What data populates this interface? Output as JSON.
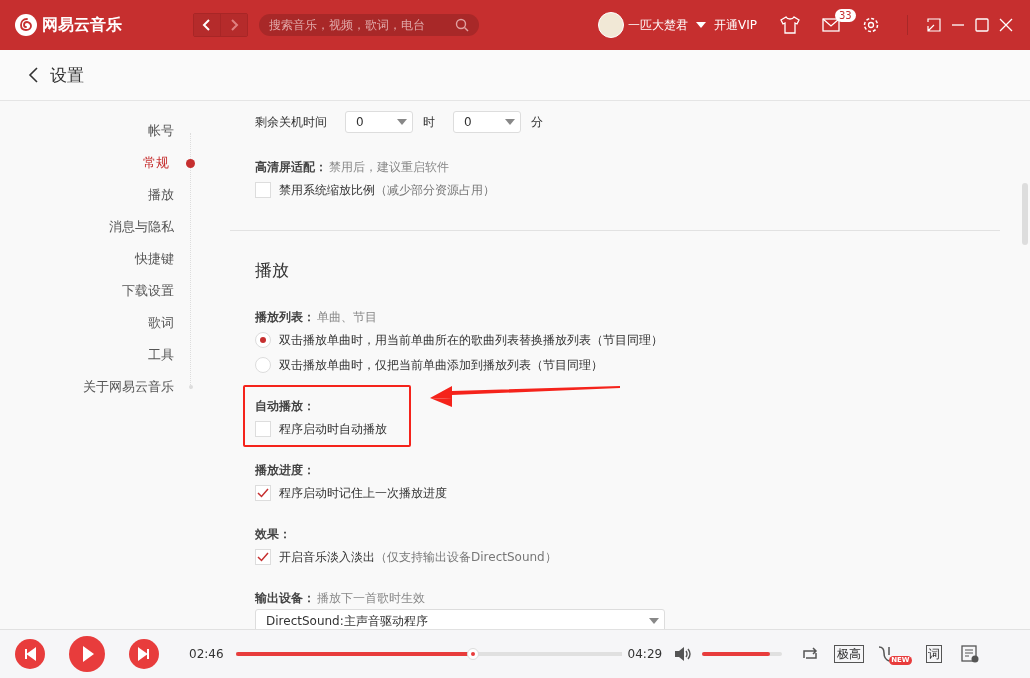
{
  "app": {
    "title": "网易云音乐",
    "search": {
      "placeholder": "搜索音乐，视频，歌词，电台"
    },
    "user": {
      "name": "一匹大楚君"
    },
    "vip": "开通VIP",
    "mail_badge": "33"
  },
  "page": {
    "title": "设置"
  },
  "nav": [
    {
      "label": "帐号",
      "selected": false
    },
    {
      "label": "常规",
      "selected": true
    },
    {
      "label": "播放",
      "selected": false
    },
    {
      "label": "消息与隐私",
      "selected": false
    },
    {
      "label": "快捷键",
      "selected": false
    },
    {
      "label": "下载设置",
      "selected": false
    },
    {
      "label": "歌词",
      "selected": false
    },
    {
      "label": "工具",
      "selected": false
    },
    {
      "label": "关于网易云音乐",
      "selected": false
    }
  ],
  "content": [
    {
      "kind": "timer",
      "label": "剩余关机时间",
      "selects": [
        {
          "value": "0",
          "unit": "时"
        },
        {
          "value": "0",
          "unit": "分"
        }
      ]
    },
    {
      "kind": "group",
      "title": "高清屏适配：",
      "note": "禁用后，建议重启软件",
      "options": [
        {
          "kind": "checkbox",
          "label": "禁用系统缩放比例",
          "note": "（减少部分资源占用）",
          "checked": false
        }
      ]
    },
    {
      "kind": "divider"
    },
    {
      "kind": "heading",
      "title": "播放"
    },
    {
      "kind": "group",
      "title": "播放列表：",
      "note": "单曲、节目",
      "options": [
        {
          "kind": "radio",
          "label": "双击播放单曲时，用当前单曲所在的歌曲列表替换播放列表（节目同理）",
          "selected": true
        },
        {
          "kind": "radio",
          "label": "双击播放单曲时，仅把当前单曲添加到播放列表（节目同理）",
          "selected": false
        }
      ]
    },
    {
      "kind": "group",
      "title": "自动播放：",
      "annotated": true,
      "options": [
        {
          "kind": "checkbox",
          "label": "程序启动时自动播放",
          "checked": false
        }
      ]
    },
    {
      "kind": "group",
      "title": "播放进度：",
      "options": [
        {
          "kind": "checkbox",
          "label": "程序启动时记住上一次播放进度",
          "checked": true
        }
      ]
    },
    {
      "kind": "group",
      "title": "效果：",
      "options": [
        {
          "kind": "checkbox",
          "label": "开启音乐淡入淡出",
          "note": "（仅支持输出设备DirectSound）",
          "checked": true
        }
      ]
    },
    {
      "kind": "group",
      "title": "输出设备：",
      "note": "播放下一首歌时生效",
      "options": [
        {
          "kind": "select",
          "value": "DirectSound:主声音驱动程序"
        }
      ]
    }
  ],
  "player": {
    "elapsed": "02:46",
    "total": "04:29",
    "progress": {
      "level": 0.615
    },
    "volume": {
      "level": 0.85
    },
    "quality": "极高",
    "new_badge": "NEW",
    "lyrics": "词"
  }
}
